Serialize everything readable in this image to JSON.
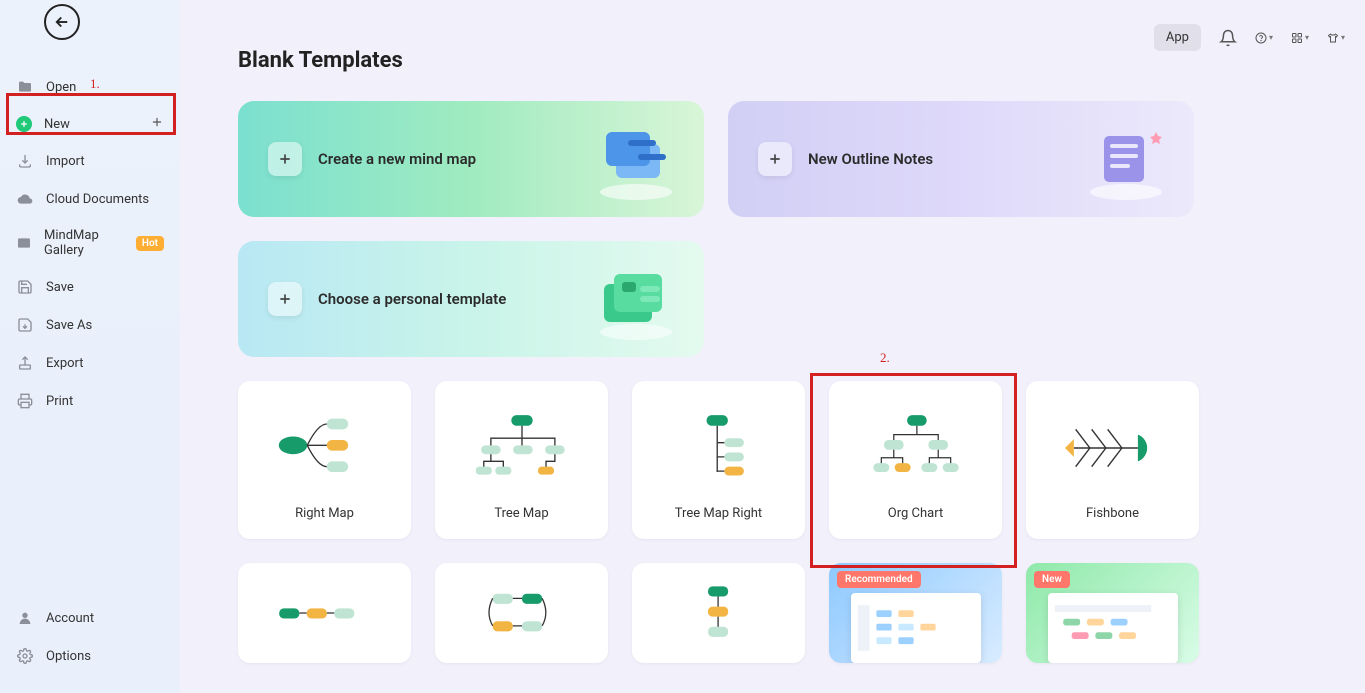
{
  "annotations": {
    "one": "1.",
    "two": "2."
  },
  "topbar": {
    "app": "App"
  },
  "sidebar": {
    "open": "Open",
    "new": "New",
    "import": "Import",
    "cloud": "Cloud Documents",
    "gallery": "MindMap Gallery",
    "gallery_badge": "Hot",
    "save": "Save",
    "saveas": "Save As",
    "export": "Export",
    "print": "Print",
    "account": "Account",
    "options": "Options"
  },
  "main": {
    "title": "Blank Templates",
    "create_mindmap": "Create a new mind map",
    "new_outline": "New Outline Notes",
    "choose_template": "Choose a personal template",
    "tiles": {
      "right_map": "Right Map",
      "tree_map": "Tree Map",
      "tree_map_right": "Tree Map Right",
      "org_chart": "Org Chart",
      "fishbone": "Fishbone"
    },
    "badges": {
      "recommended": "Recommended",
      "new": "New"
    }
  }
}
